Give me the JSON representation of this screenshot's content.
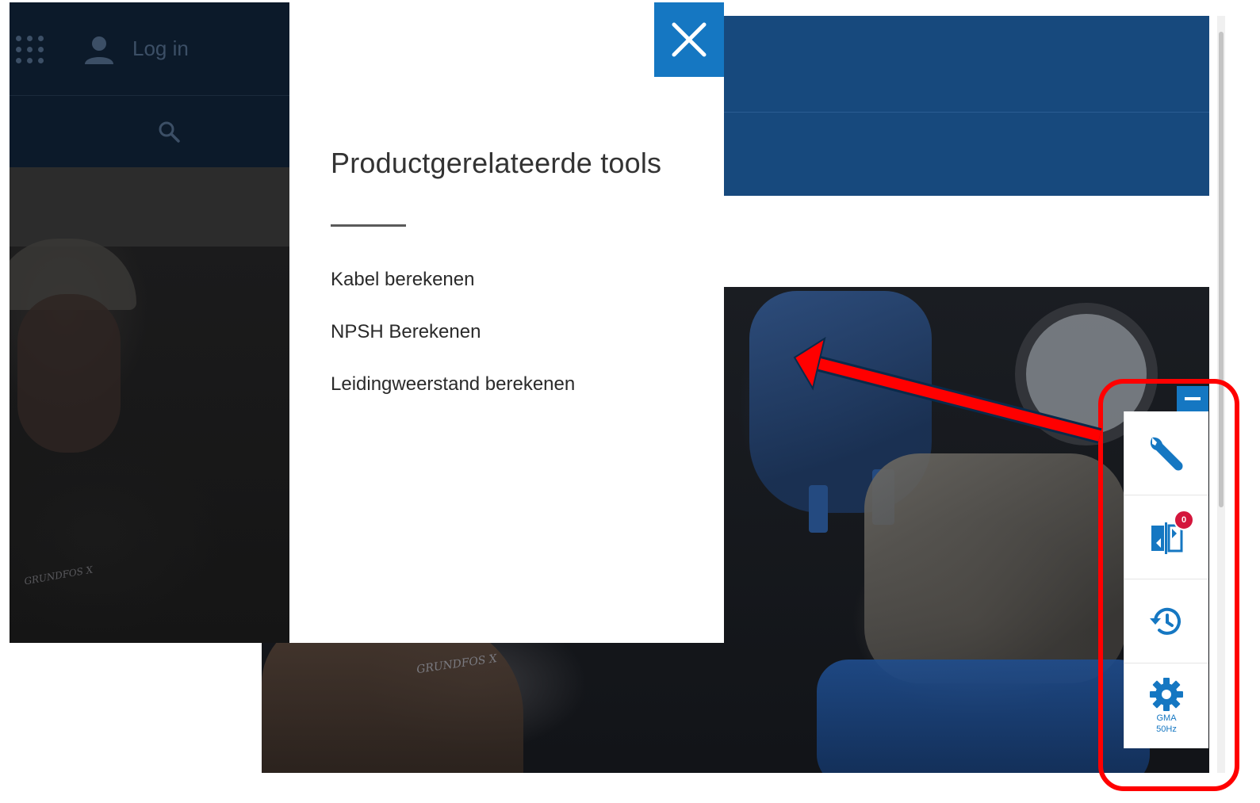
{
  "front_header": {
    "login_label": "Log in"
  },
  "modal": {
    "title": "Productgerelateerde tools",
    "tools": [
      {
        "label": "Kabel berekenen"
      },
      {
        "label": "NPSH Berekenen"
      },
      {
        "label": "Leidingweerstand berekenen"
      }
    ],
    "close_icon": "close-icon"
  },
  "toolbar": {
    "items": [
      {
        "icon": "wrench-icon"
      },
      {
        "icon": "compare-icon",
        "badge": "0"
      },
      {
        "icon": "history-icon"
      },
      {
        "icon": "gear-icon",
        "caption_line1": "GMA",
        "caption_line2": "50Hz"
      }
    ],
    "minimize_icon": "minimize-icon"
  },
  "photo_logo": "GRUNDFOS X",
  "colors": {
    "brand_blue": "#1577c2",
    "header_navy": "#17497d",
    "annotation_red": "#ff0000",
    "badge_red": "#d4163c"
  }
}
